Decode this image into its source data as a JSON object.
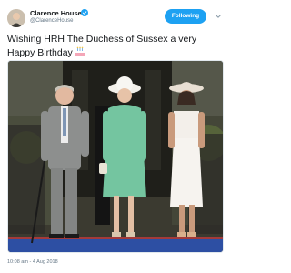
{
  "tweet": {
    "author_name": "Clarence House",
    "author_handle": "@ClarenceHouse",
    "follow_label": "Following",
    "text": "Wishing HRH The Duchess of Sussex a very Happy Birthday",
    "timestamp": "10:08 am - 4 Aug 2018"
  },
  "icons": {
    "verified": "verified-badge-icon",
    "menu": "chevron-down-icon",
    "emoji": "birthday-cake-emoji"
  },
  "colors": {
    "accent": "#1da1f2",
    "text": "#14171a",
    "muted": "#657786"
  }
}
